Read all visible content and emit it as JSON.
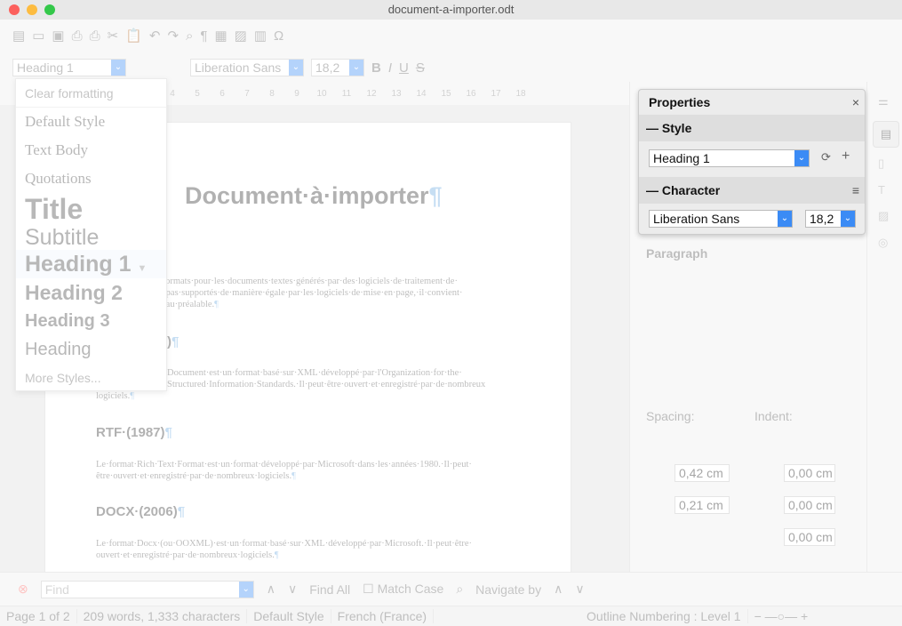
{
  "window": {
    "title": "document-a-importer.odt"
  },
  "formatting": {
    "style": "Heading 1",
    "font": "Liberation Sans",
    "size": "18,2"
  },
  "ruler": [
    "4",
    "5",
    "6",
    "7",
    "8",
    "9",
    "10",
    "11",
    "12",
    "13",
    "14",
    "15",
    "16",
    "17",
    "18"
  ],
  "style_menu": {
    "items": [
      "Clear formatting",
      "Default Style",
      "Text Body",
      "Quotations",
      "Title",
      "Subtitle",
      "Heading 1",
      "Heading 2",
      "Heading 3",
      "Heading",
      "More Styles..."
    ]
  },
  "document": {
    "title": "Document·à·importer",
    "p1": [
      "s·formats·pour·les·documents·textes·générés·par·des·logiciels·de·traitement·de·",
      "nt·pas·supportés·de·manière·égale·par·les·logiciels·de·mise·en·page,·il·convient·",
      "er·au·préalable."
    ],
    "h_odt": ")",
    "p2": [
      "Document·est·un·format·basé·sur·XML·développé·par·l'Organization·for·the·",
      "Structured·Information·Standards.·Il·peut·être·ouvert·et·enregistré·par·de·nombreux",
      "logiciels."
    ],
    "h_rtf": "RTF·(1987)",
    "p3": [
      "Le·format·Rich·Text·Format·est·un·format·développé·par·Microsoft·dans·les·années·1980.·Il·peut·",
      "être·ouvert·et·enregistré·par·de·nombreux·logiciels."
    ],
    "h_docx": "DOCX·(2006)",
    "p4": [
      "Le·format·Docx·(ou·OOXML)·est·un·format·basé·sur·XML·développé·par·Microsoft.·Il·peut·être·",
      "ouvert·et·enregistré·par·de·nombreux·logiciels."
    ],
    "pilcrow": "¶"
  },
  "properties": {
    "title": "Properties",
    "close": "×",
    "style_section": "Style",
    "style_value": "Heading 1",
    "character_section": "Character",
    "font": "Liberation Sans",
    "size": "18,2"
  },
  "sidebar": {
    "paragraph": "Paragraph",
    "spacing": "Spacing:",
    "indent": "Indent:",
    "above": "0,42 cm",
    "below": "0,21 cm",
    "indent_before": "0,00 cm",
    "indent_after": "0,00 cm",
    "first_line": "0,00 cm"
  },
  "findbar": {
    "placeholder": "Find",
    "find_all": "Find All",
    "match_case": "Match Case",
    "navigate_by": "Navigate by"
  },
  "status": {
    "page": "Page 1 of 2",
    "words": "209 words, 1,333 characters",
    "style": "Default Style",
    "language": "French (France)",
    "outline": "Outline Numbering : Level 1"
  },
  "colors": {
    "accent": "#3b8bf5",
    "close": "#fc605c",
    "minimize": "#fdbc40",
    "maximize": "#34c84a"
  }
}
